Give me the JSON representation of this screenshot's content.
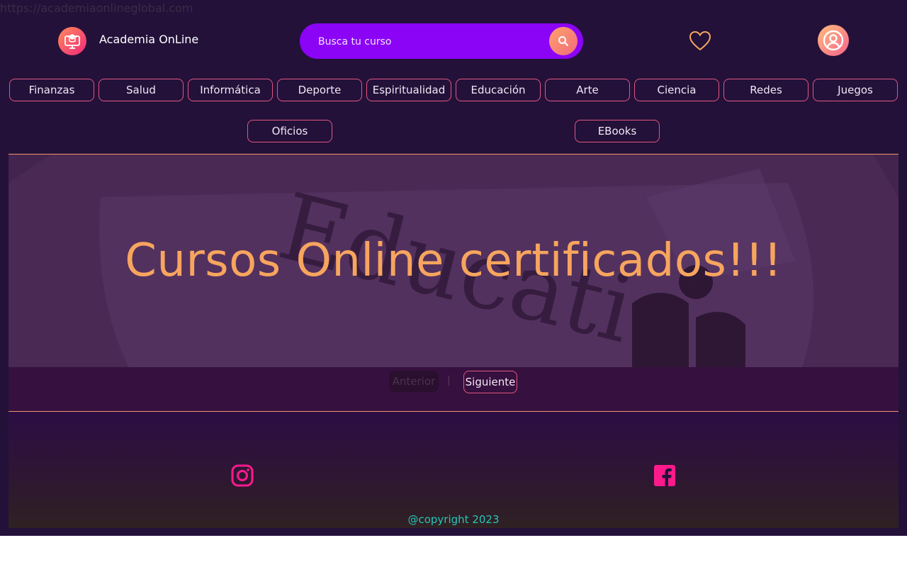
{
  "browser": {
    "url": "https://academiaonlineglobal.com"
  },
  "header": {
    "brand_name": "Academia OnLine",
    "logo_icon": "graduation-cap-monitor-icon",
    "search": {
      "placeholder": "Busca tu curso",
      "value": "",
      "button_icon": "search-icon"
    },
    "favorites_icon": "heart-icon",
    "account_icon": "user-circle-icon"
  },
  "categories": [
    "Finanzas",
    "Salud",
    "Informática",
    "Deporte",
    "Espiritualidad",
    "Educación",
    "Arte",
    "Ciencia",
    "Redes",
    "Juegos",
    "Oficios",
    "EBooks"
  ],
  "hero": {
    "title": "Cursos Online certificados!!!",
    "background_text": "Educati"
  },
  "pager": {
    "prev_label": "Anterior",
    "separator": "|",
    "next_label": "Siguiente"
  },
  "footer": {
    "social": [
      "instagram-icon",
      "facebook-icon"
    ],
    "copyright": "@copyright 2023"
  },
  "colors": {
    "page_bg": "#23113a",
    "accent_orange": "#f7a55e",
    "search_purple": "#8b04f6",
    "border_pink": "#e2567f",
    "social_pink": "#ff1a8c",
    "copyright_teal": "#26c6b8"
  }
}
